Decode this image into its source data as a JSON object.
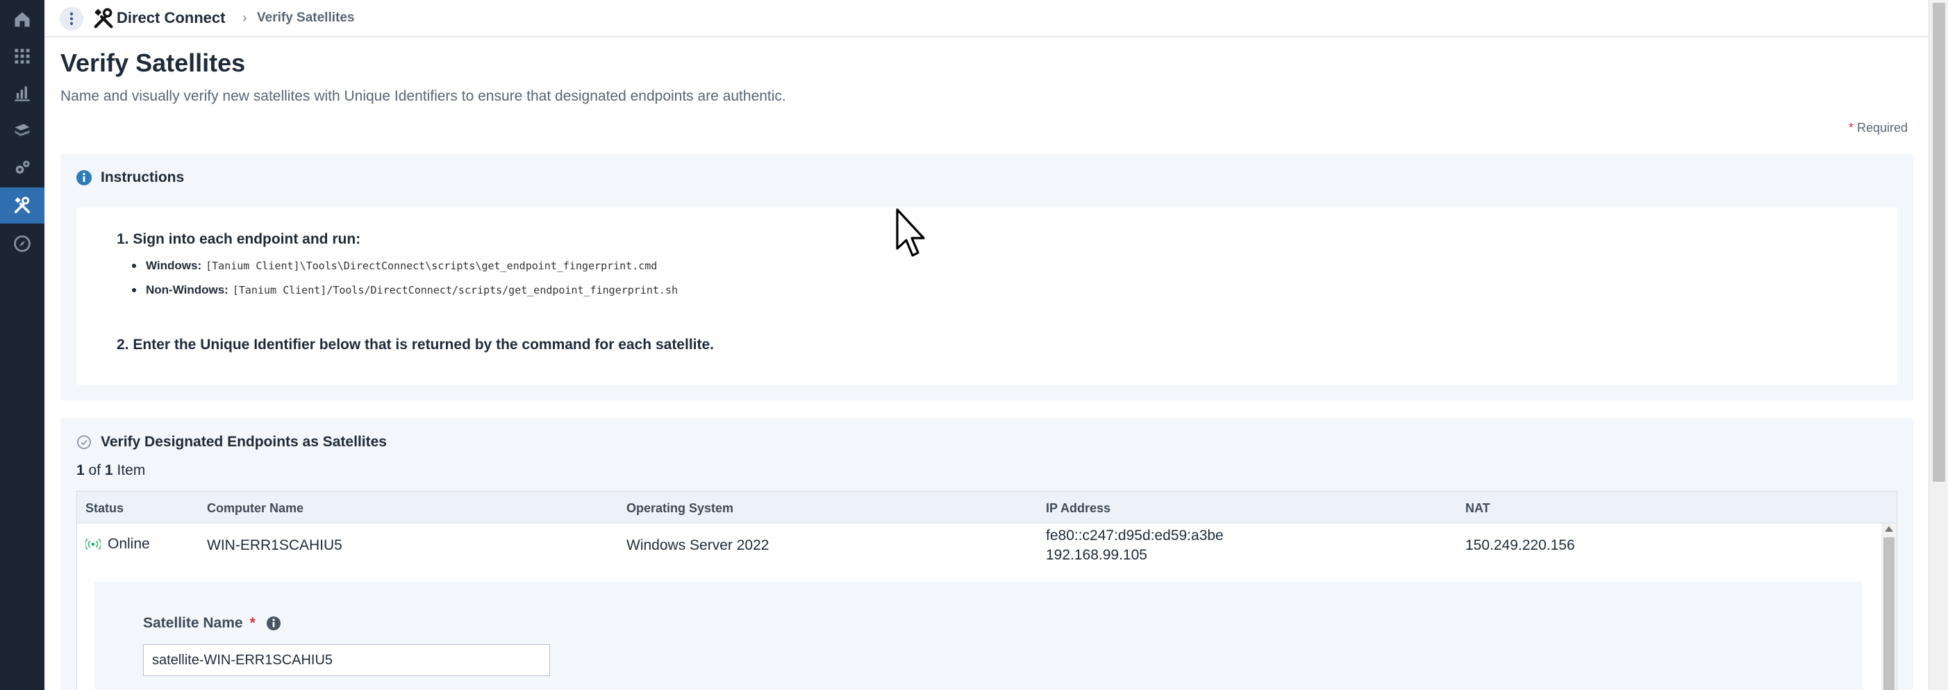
{
  "nav": {
    "items": [
      {
        "icon": "home-icon"
      },
      {
        "icon": "apps-grid-icon"
      },
      {
        "icon": "bar-chart-icon"
      },
      {
        "icon": "layers-icon"
      },
      {
        "icon": "gears-icon"
      },
      {
        "icon": "tools-icon",
        "active": true
      },
      {
        "icon": "compass-icon"
      }
    ]
  },
  "breadcrumb": {
    "app": "Direct Connect",
    "separator": "›",
    "current": "Verify Satellites"
  },
  "header": {
    "title": "Verify Satellites",
    "description": "Name and visually verify new satellites with Unique Identifiers to ensure that designated endpoints are authentic.",
    "required_star": "*",
    "required_label": "Required"
  },
  "instructions": {
    "title": "Instructions",
    "step1": "1. Sign into each endpoint and run:",
    "windows_label": "Windows:",
    "windows_cmd": "[Tanium Client]\\Tools\\DirectConnect\\scripts\\get_endpoint_fingerprint.cmd",
    "nonwindows_label": "Non-Windows:",
    "nonwindows_cmd": "[Tanium Client]/Tools/DirectConnect/scripts/get_endpoint_fingerprint.sh",
    "step2": "2. Enter the Unique Identifier below that is returned by the command for each satellite."
  },
  "verify": {
    "title": "Verify Designated Endpoints as Satellites",
    "count_current": "1",
    "count_of": "of",
    "count_total": "1",
    "count_unit": "Item",
    "columns": {
      "status": "Status",
      "computer_name": "Computer Name",
      "os": "Operating System",
      "ip": "IP Address",
      "nat": "NAT"
    },
    "rows": [
      {
        "status": "Online",
        "computer_name": "WIN-ERR1SCAHIU5",
        "os": "Windows Server 2022",
        "ip_v6": "fe80::c247:d95d:ed59:a3be",
        "ip_v4": "192.168.99.105",
        "nat": "150.249.220.156"
      }
    ],
    "satellite_name_label": "Satellite Name",
    "satellite_name_star": "*",
    "satellite_name_value": "satellite-WIN-ERR1SCAHIU5"
  },
  "colors": {
    "rail_bg": "#1c2533",
    "rail_active": "#2f6fb0",
    "accent": "#2f7ab8",
    "required": "#d6313b",
    "online": "#2bb673"
  }
}
